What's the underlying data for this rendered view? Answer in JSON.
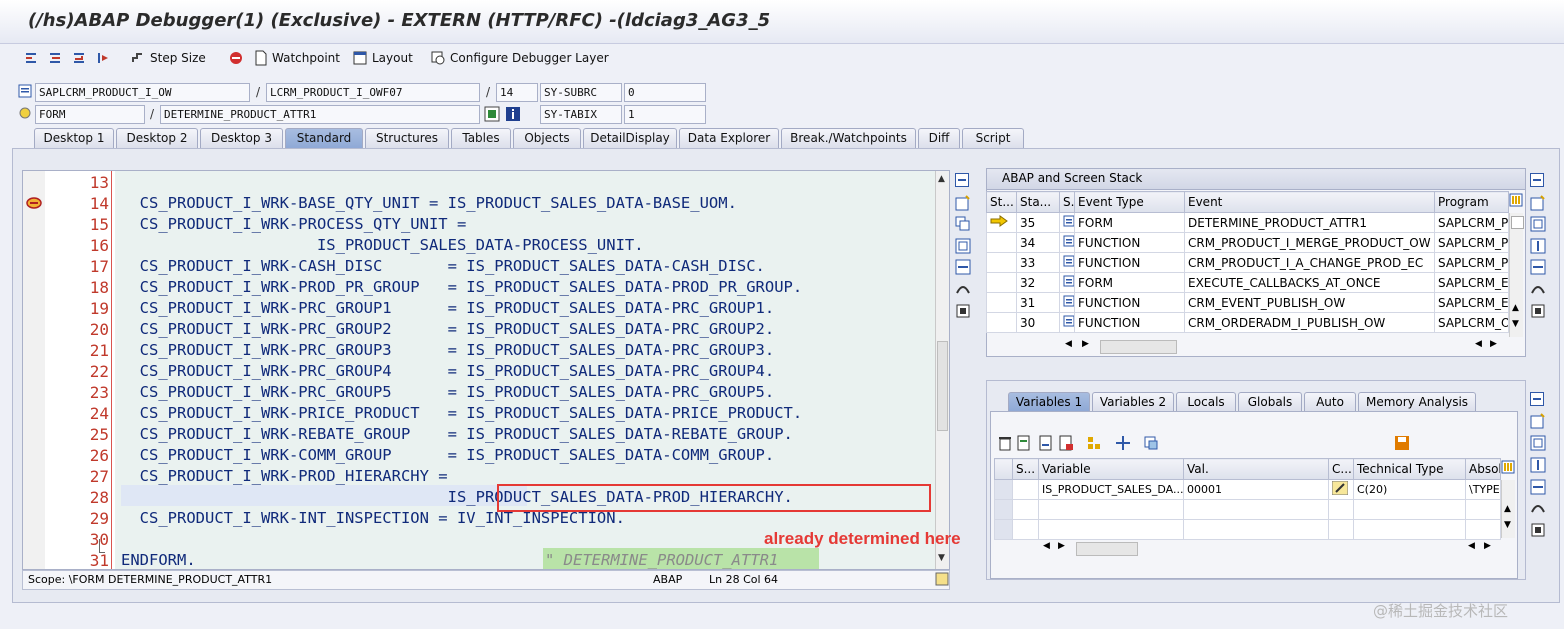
{
  "window": {
    "title": "(/hs)ABAP Debugger(1)  (Exclusive) - EXTERN (HTTP/RFC) -(ldciag3_AG3_5"
  },
  "toolbar": {
    "step_size": "Step Size",
    "watchpoint": "Watchpoint",
    "layout": "Layout",
    "configure": "Configure Debugger Layer"
  },
  "info": {
    "program": "SAPLCRM_PRODUCT_I_OW",
    "include": "LCRM_PRODUCT_I_OWF07",
    "line": "14",
    "sy_subrc_label": "SY-SUBRC",
    "sy_subrc_value": "0",
    "event_type": "FORM",
    "event_name": "DETERMINE_PRODUCT_ATTR1",
    "sy_tabix_label": "SY-TABIX",
    "sy_tabix_value": "1",
    "slash": "/"
  },
  "tabs": [
    "Desktop 1",
    "Desktop 2",
    "Desktop 3",
    "Standard",
    "Structures",
    "Tables",
    "Objects",
    "DetailDisplay",
    "Data Explorer",
    "Break./Watchpoints",
    "Diff",
    "Script"
  ],
  "code": {
    "lines": [
      {
        "n": "13",
        "text": ""
      },
      {
        "n": "14",
        "text": "  CS_PRODUCT_I_WRK-BASE_QTY_UNIT = IS_PRODUCT_SALES_DATA-BASE_UOM."
      },
      {
        "n": "15",
        "text": "  CS_PRODUCT_I_WRK-PROCESS_QTY_UNIT ="
      },
      {
        "n": "16",
        "text": "                     IS_PRODUCT_SALES_DATA-PROCESS_UNIT."
      },
      {
        "n": "17",
        "text": "  CS_PRODUCT_I_WRK-CASH_DISC       = IS_PRODUCT_SALES_DATA-CASH_DISC."
      },
      {
        "n": "18",
        "text": "  CS_PRODUCT_I_WRK-PROD_PR_GROUP   = IS_PRODUCT_SALES_DATA-PROD_PR_GROUP."
      },
      {
        "n": "19",
        "text": "  CS_PRODUCT_I_WRK-PRC_GROUP1      = IS_PRODUCT_SALES_DATA-PRC_GROUP1."
      },
      {
        "n": "20",
        "text": "  CS_PRODUCT_I_WRK-PRC_GROUP2      = IS_PRODUCT_SALES_DATA-PRC_GROUP2."
      },
      {
        "n": "21",
        "text": "  CS_PRODUCT_I_WRK-PRC_GROUP3      = IS_PRODUCT_SALES_DATA-PRC_GROUP3."
      },
      {
        "n": "22",
        "text": "  CS_PRODUCT_I_WRK-PRC_GROUP4      = IS_PRODUCT_SALES_DATA-PRC_GROUP4."
      },
      {
        "n": "23",
        "text": "  CS_PRODUCT_I_WRK-PRC_GROUP5      = IS_PRODUCT_SALES_DATA-PRC_GROUP5."
      },
      {
        "n": "24",
        "text": "  CS_PRODUCT_I_WRK-PRICE_PRODUCT   = IS_PRODUCT_SALES_DATA-PRICE_PRODUCT."
      },
      {
        "n": "25",
        "text": "  CS_PRODUCT_I_WRK-REBATE_GROUP    = IS_PRODUCT_SALES_DATA-REBATE_GROUP."
      },
      {
        "n": "26",
        "text": "  CS_PRODUCT_I_WRK-COMM_GROUP      = IS_PRODUCT_SALES_DATA-COMM_GROUP."
      },
      {
        "n": "27",
        "text": "  CS_PRODUCT_I_WRK-PROD_HIERARCHY ="
      },
      {
        "n": "28",
        "text": "                                   IS_PRODUCT_SALES_DATA-PROD_HIERARCHY."
      },
      {
        "n": "29",
        "text": "  CS_PRODUCT_I_WRK-INT_INSPECTION = IV_INT_INSPECTION."
      },
      {
        "n": "30",
        "text": ""
      },
      {
        "n": "31",
        "text": "ENDFORM."
      }
    ],
    "endform_comment": "\" DETERMINE_PRODUCT_ATTR1",
    "annotation": "already determined here"
  },
  "status": {
    "scope": "Scope: \\FORM DETERMINE_PRODUCT_ATTR1",
    "lang": "ABAP",
    "pos": "Ln  28 Col  64"
  },
  "stack": {
    "title": "ABAP and Screen Stack",
    "headers": [
      "St...",
      "Sta...",
      "S...",
      "Event Type",
      "Event",
      "Program"
    ],
    "rows": [
      {
        "level": "35",
        "type": "FORM",
        "event": "DETERMINE_PRODUCT_ATTR1",
        "program": "SAPLCRM_P"
      },
      {
        "level": "34",
        "type": "FUNCTION",
        "event": "CRM_PRODUCT_I_MERGE_PRODUCT_OW",
        "program": "SAPLCRM_P"
      },
      {
        "level": "33",
        "type": "FUNCTION",
        "event": "CRM_PRODUCT_I_A_CHANGE_PROD_EC",
        "program": "SAPLCRM_P"
      },
      {
        "level": "32",
        "type": "FORM",
        "event": "EXECUTE_CALLBACKS_AT_ONCE",
        "program": "SAPLCRM_E"
      },
      {
        "level": "31",
        "type": "FUNCTION",
        "event": "CRM_EVENT_PUBLISH_OW",
        "program": "SAPLCRM_E"
      },
      {
        "level": "30",
        "type": "FUNCTION",
        "event": "CRM_ORDERADM_I_PUBLISH_OW",
        "program": "SAPLCRM_O"
      }
    ]
  },
  "vartabs": [
    "Variables 1",
    "Variables 2",
    "Locals",
    "Globals",
    "Auto",
    "Memory Analysis"
  ],
  "vars": {
    "headers": [
      "S...",
      "Variable",
      "Val.",
      "C...",
      "Technical Type",
      "Absolu"
    ],
    "rows": [
      {
        "variable": "IS_PRODUCT_SALES_DA...",
        "value": "00001",
        "type": "C(20)",
        "abs": "\\TYPE"
      }
    ]
  },
  "watermark": "@稀土掘金技术社区"
}
